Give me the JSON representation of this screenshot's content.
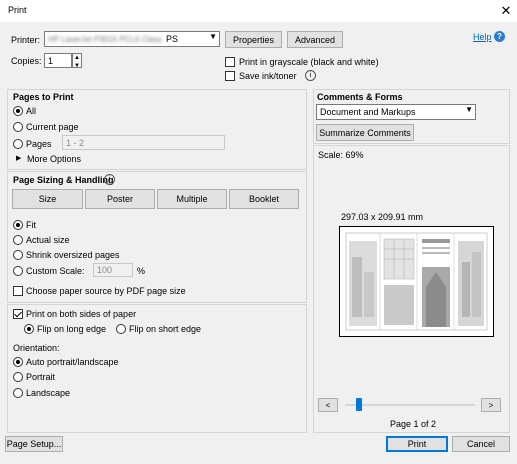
{
  "window": {
    "title": "Print",
    "close": "✕"
  },
  "printer": {
    "label": "Printer:",
    "value_blurred": "HP LaserJet P3015 PCL6 Class Driver",
    "value_suffix": "PS",
    "properties_button": "Properties",
    "advanced_button": "Advanced",
    "help_link": "Help",
    "help_icon": "question-icon"
  },
  "copies": {
    "label": "Copies:",
    "value": "1",
    "grayscale_label": "Print in grayscale (black and white)",
    "save_ink_label": "Save ink/toner",
    "info_icon": "info-icon"
  },
  "pages_to_print": {
    "heading": "Pages to Print",
    "all": "All",
    "current": "Current page",
    "pages": "Pages",
    "pages_value": "1 - 2",
    "more_options": "More Options"
  },
  "sizing": {
    "heading": "Page Sizing & Handling",
    "tabs": [
      "Size",
      "Poster",
      "Multiple",
      "Booklet"
    ],
    "fit": "Fit",
    "actual": "Actual size",
    "shrink": "Shrink oversized pages",
    "custom": "Custom Scale:",
    "custom_value": "100",
    "custom_unit": "%",
    "paper_source": "Choose paper source by PDF page size"
  },
  "duplex": {
    "both_sides": "Print on both sides of paper",
    "long_edge": "Flip on long edge",
    "short_edge": "Flip on short edge"
  },
  "orientation": {
    "label": "Orientation:",
    "auto": "Auto portrait/landscape",
    "portrait": "Portrait",
    "landscape": "Landscape"
  },
  "comments_forms": {
    "heading": "Comments & Forms",
    "selected": "Document and Markups",
    "summarize_button": "Summarize Comments"
  },
  "preview": {
    "scale": "Scale:  69%",
    "dimensions": "297.03 x 209.91 mm",
    "prev": "<",
    "next": ">",
    "slider_fraction": 0.0,
    "page_indicator": "Page 1 of 2"
  },
  "footer": {
    "page_setup": "Page Setup...",
    "print": "Print",
    "cancel": "Cancel"
  },
  "colors": {
    "accent": "#0078d7",
    "link": "#0066cc"
  }
}
